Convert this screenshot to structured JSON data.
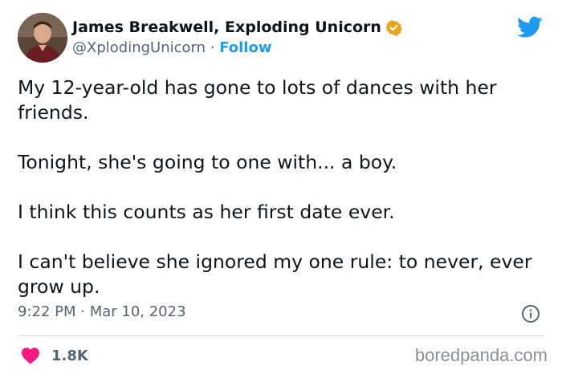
{
  "author": {
    "display_name": "James Breakwell, Exploding Unicorn",
    "handle": "@XplodingUnicorn",
    "separator": " · ",
    "follow_label": "Follow"
  },
  "tweet": {
    "paragraphs": [
      "My 12-year-old has gone to lots of dances with her friends.",
      "Tonight, she's going to one with... a boy.",
      "I think this counts as her first date ever.",
      "I can't believe she ignored my one rule: to never, ever grow up."
    ],
    "timestamp": "9:22 PM · Mar 10, 2023"
  },
  "engagement": {
    "like_count": "1.8K"
  },
  "watermark": "boredpanda.com",
  "colors": {
    "accent": "#1d9bf0",
    "verified": "#e8a317",
    "heart": "#f91880",
    "muted": "#536471"
  },
  "icons": [
    "avatar",
    "verified-badge-icon",
    "twitter-bird-icon",
    "info-icon",
    "heart-icon"
  ]
}
